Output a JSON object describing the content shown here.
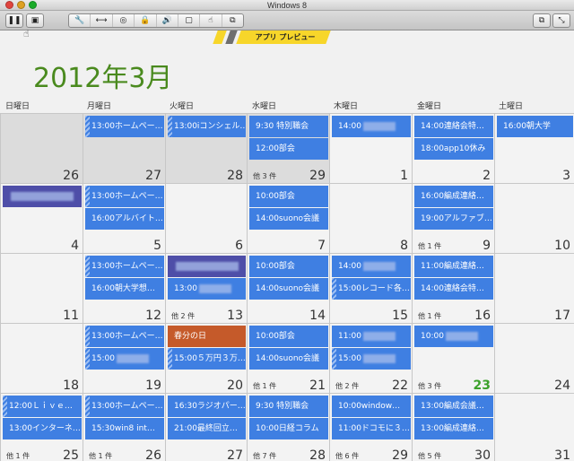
{
  "window": {
    "title": "Windows 8"
  },
  "toolbar": {
    "pause_label": "❚❚",
    "screenshot_label": "▣",
    "group_icons": [
      "wrench-icon",
      "resize-arrows-icon",
      "cd-icon",
      "lock-icon",
      "speaker-icon",
      "usb-icon",
      "hand-icon",
      "share-icon"
    ],
    "group_glyphs": [
      "🔧",
      "⟷",
      "◎",
      "🔒",
      "🔊",
      "▢",
      "☝",
      "⧉"
    ],
    "right1_label": "⧉",
    "right2_label": "⤡"
  },
  "banner": {
    "text": "アプリ プレビュー"
  },
  "month_title": "2012年3月",
  "day_headers": [
    "日曜日",
    "月曜日",
    "火曜日",
    "水曜日",
    "木曜日",
    "金曜日",
    "土曜日"
  ],
  "weeks": [
    {
      "days": [
        {
          "num": "26",
          "other": true,
          "more": "",
          "events": []
        },
        {
          "num": "27",
          "other": true,
          "more": "",
          "events": [
            {
              "text": "13:00ホームペー…",
              "cont": true
            }
          ]
        },
        {
          "num": "28",
          "other": true,
          "more": "",
          "events": [
            {
              "text": "13:00iコンシェル…",
              "cont": true
            }
          ]
        },
        {
          "num": "29",
          "other": true,
          "more": "他 3 件",
          "events": [
            {
              "text": "9:30 特別職会"
            },
            {
              "text": "12:00部会"
            }
          ]
        },
        {
          "num": "1",
          "more": "",
          "events": [
            {
              "text": "14:00",
              "blur": true
            }
          ]
        },
        {
          "num": "2",
          "more": "",
          "events": [
            {
              "text": "14:00連絡会特…"
            },
            {
              "text": "18:00app10休み"
            }
          ]
        },
        {
          "num": "3",
          "more": "",
          "events": [
            {
              "text": "16:00朝大学"
            }
          ]
        }
      ]
    },
    {
      "days": [
        {
          "num": "4",
          "more": "",
          "events": [
            {
              "text": "",
              "purple": true,
              "blurlong": true
            }
          ]
        },
        {
          "num": "5",
          "more": "",
          "events": [
            {
              "text": "13:00ホームペー…",
              "cont": true
            },
            {
              "text": "16:00アルバイト…"
            }
          ]
        },
        {
          "num": "6",
          "more": "",
          "events": []
        },
        {
          "num": "7",
          "more": "",
          "events": [
            {
              "text": "10:00部会"
            },
            {
              "text": "14:00suono会議"
            }
          ]
        },
        {
          "num": "8",
          "more": "",
          "events": []
        },
        {
          "num": "9",
          "more": "他 1 件",
          "events": [
            {
              "text": "16:00編成連絡…"
            },
            {
              "text": "19:00アルファブ…"
            }
          ]
        },
        {
          "num": "10",
          "more": "",
          "events": []
        }
      ]
    },
    {
      "days": [
        {
          "num": "11",
          "more": "",
          "events": []
        },
        {
          "num": "12",
          "more": "",
          "events": [
            {
              "text": "13:00ホームペー…",
              "cont": true
            },
            {
              "text": "16:00朝大学想…"
            }
          ]
        },
        {
          "num": "13",
          "more": "他 2 件",
          "events": [
            {
              "text": "",
              "purple": true,
              "blurlong": true
            },
            {
              "text": "13:00",
              "blur": true
            }
          ]
        },
        {
          "num": "14",
          "more": "",
          "events": [
            {
              "text": "10:00部会"
            },
            {
              "text": "14:00suono会議"
            }
          ]
        },
        {
          "num": "15",
          "more": "",
          "events": [
            {
              "text": "14:00",
              "blur": true
            },
            {
              "text": "15:00レコード各…",
              "cont": true
            }
          ]
        },
        {
          "num": "16",
          "more": "他 1 件",
          "events": [
            {
              "text": "11:00編成連絡…"
            },
            {
              "text": "14:00連絡会特…"
            }
          ]
        },
        {
          "num": "17",
          "more": "",
          "events": []
        }
      ]
    },
    {
      "days": [
        {
          "num": "18",
          "more": "",
          "events": []
        },
        {
          "num": "19",
          "more": "",
          "events": [
            {
              "text": "13:00ホームペー…",
              "cont": true
            },
            {
              "text": "15:00",
              "blur": true,
              "cont": true
            }
          ]
        },
        {
          "num": "20",
          "more": "",
          "events": [
            {
              "text": "春分の日",
              "orange": true
            },
            {
              "text": "15:00５万円３万…",
              "cont": true
            }
          ]
        },
        {
          "num": "21",
          "more": "他 1 件",
          "events": [
            {
              "text": "10:00部会"
            },
            {
              "text": "14:00suono会議"
            }
          ]
        },
        {
          "num": "22",
          "more": "他 2 件",
          "events": [
            {
              "text": "11:00",
              "blur": true
            },
            {
              "text": "15:00",
              "blur": true,
              "cont": true
            }
          ]
        },
        {
          "num": "23",
          "today": true,
          "more": "他 3 件",
          "events": [
            {
              "text": "10:00",
              "blur": true
            }
          ]
        },
        {
          "num": "24",
          "more": "",
          "events": []
        }
      ]
    },
    {
      "days": [
        {
          "num": "25",
          "more": "他 1 件",
          "events": [
            {
              "text": "12:00Ｌｉｖｅ…",
              "cont": true
            },
            {
              "text": "13:00インターネ…"
            }
          ]
        },
        {
          "num": "26",
          "more": "他 1 件",
          "events": [
            {
              "text": "13:00ホームペー…",
              "cont": true
            },
            {
              "text": "15:30win8 int…"
            }
          ]
        },
        {
          "num": "27",
          "more": "",
          "events": [
            {
              "text": "16:30ラジオパー…"
            },
            {
              "text": "21:00最終回立…"
            }
          ]
        },
        {
          "num": "28",
          "more": "他 7 件",
          "events": [
            {
              "text": "9:30 特別職会"
            },
            {
              "text": "10:00日経コラム"
            }
          ]
        },
        {
          "num": "29",
          "more": "他 6 件",
          "events": [
            {
              "text": "10:00window…"
            },
            {
              "text": "11:00ドコモに３…"
            }
          ]
        },
        {
          "num": "30",
          "more": "他 5 件",
          "events": [
            {
              "text": "13:00編成会議…"
            },
            {
              "text": "13:00編成連絡…"
            }
          ]
        },
        {
          "num": "31",
          "more": "",
          "events": []
        }
      ]
    }
  ]
}
